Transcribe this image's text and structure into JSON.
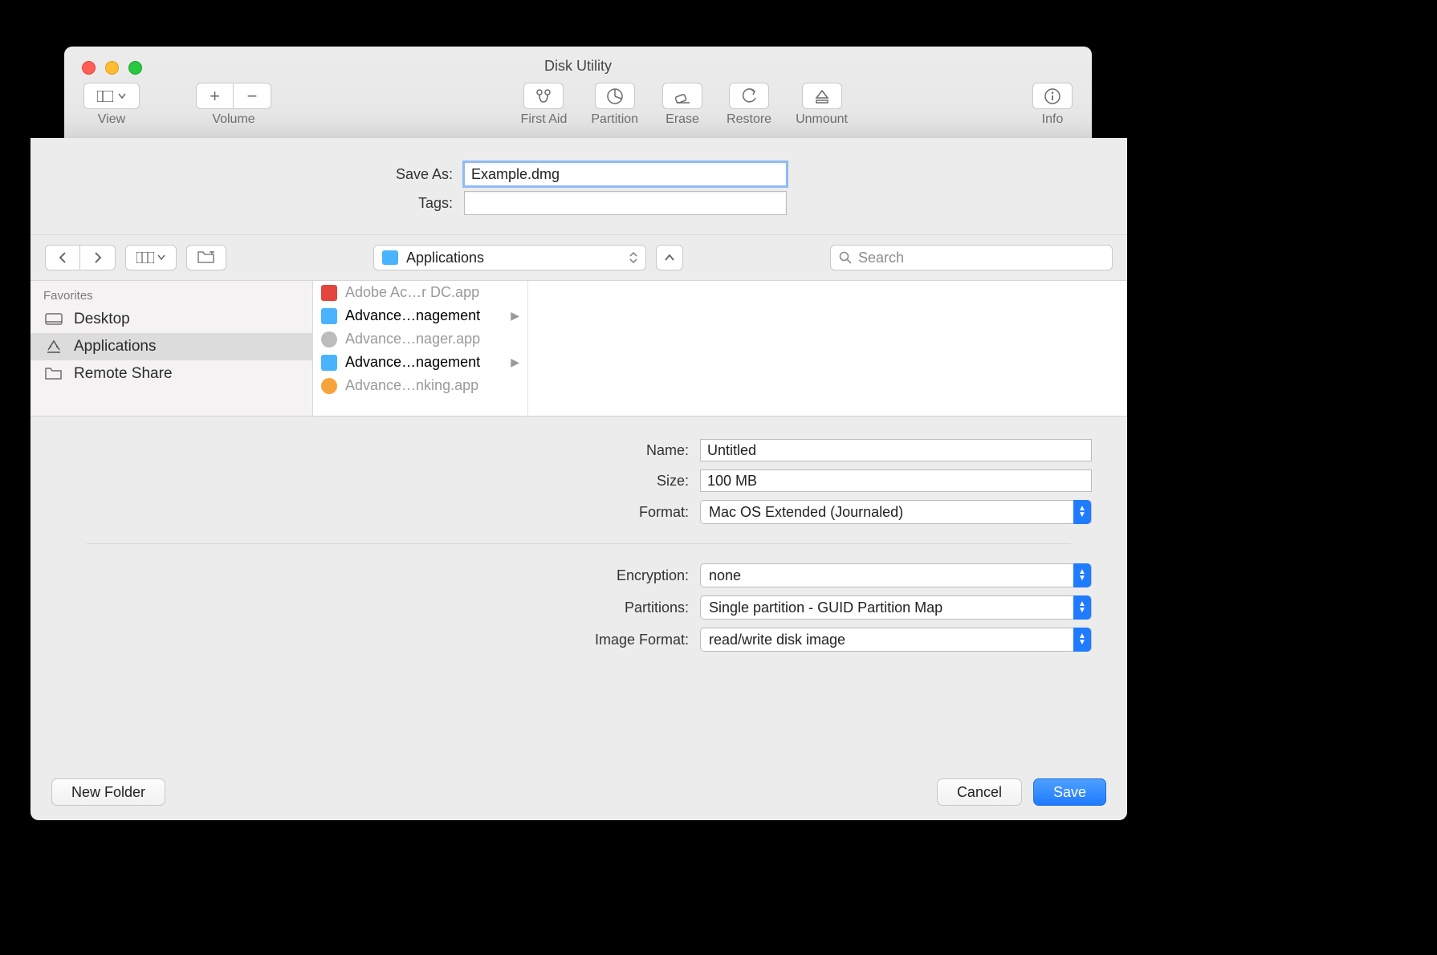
{
  "window": {
    "title": "Disk Utility",
    "toolbar": {
      "view_label": "View",
      "volume_label": "Volume",
      "firstaid_label": "First Aid",
      "partition_label": "Partition",
      "erase_label": "Erase",
      "restore_label": "Restore",
      "unmount_label": "Unmount",
      "info_label": "Info"
    }
  },
  "sheet": {
    "save_as_label": "Save As:",
    "save_as_value": "Example.dmg",
    "tags_label": "Tags:",
    "tags_value": "",
    "location_label": "Applications",
    "search_placeholder": "Search",
    "sidebar": {
      "heading": "Favorites",
      "items": [
        {
          "label": "Desktop",
          "icon": "desktop"
        },
        {
          "label": "Applications",
          "icon": "applications"
        },
        {
          "label": "Remote Share",
          "icon": "folder"
        }
      ]
    },
    "files": [
      {
        "label": "Adobe Ac…r DC.app",
        "kind": "pdf",
        "dim": true,
        "folder": false
      },
      {
        "label": "Advance…nagement",
        "kind": "folder",
        "dim": false,
        "folder": true
      },
      {
        "label": "Advance…nager.app",
        "kind": "app1",
        "dim": true,
        "folder": false
      },
      {
        "label": "Advance…nagement",
        "kind": "folder",
        "dim": false,
        "folder": true
      },
      {
        "label": "Advance…nking.app",
        "kind": "app2",
        "dim": true,
        "folder": false
      }
    ],
    "options": {
      "name_label": "Name:",
      "name_value": "Untitled",
      "size_label": "Size:",
      "size_value": "100 MB",
      "format_label": "Format:",
      "format_value": "Mac OS Extended (Journaled)",
      "encryption_label": "Encryption:",
      "encryption_value": "none",
      "partitions_label": "Partitions:",
      "partitions_value": "Single partition - GUID Partition Map",
      "imageformat_label": "Image Format:",
      "imageformat_value": "read/write disk image"
    },
    "footer": {
      "new_folder": "New Folder",
      "cancel": "Cancel",
      "save": "Save"
    }
  }
}
